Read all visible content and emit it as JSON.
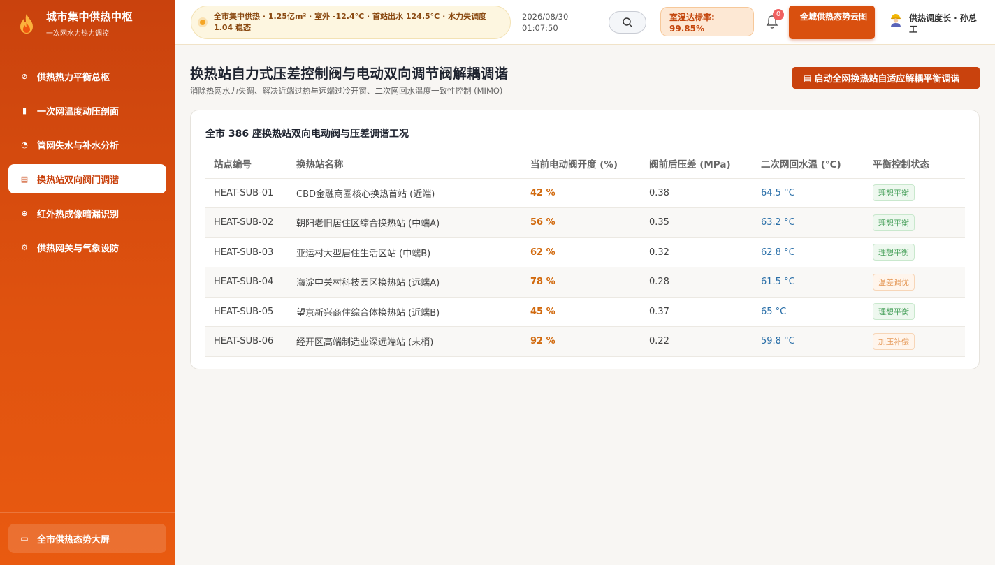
{
  "sidebar": {
    "brand_title": "城市集中供热中枢",
    "brand_sub": "一次网水力热力调控",
    "items": [
      {
        "icon": "compass-icon",
        "glyph": "⊘",
        "label": "供热热力平衡总枢"
      },
      {
        "icon": "bar-chart-icon",
        "glyph": "▮",
        "label": "一次网温度动压剖面"
      },
      {
        "icon": "gauge-icon",
        "glyph": "◔",
        "label": "管网失水与补水分析"
      },
      {
        "icon": "valve-panel-icon",
        "glyph": "▤",
        "label": "换热站双向阀门调谐"
      },
      {
        "icon": "crosshair-icon",
        "glyph": "⊕",
        "label": "红外热成像暗漏识别"
      },
      {
        "icon": "gear-icon",
        "glyph": "⚙",
        "label": "供热网关与气象设防"
      }
    ],
    "active_index": 3,
    "footer_label": "全市供热态势大屏",
    "footer_icon": "monitor-icon"
  },
  "header": {
    "ticker": "全市集中供热 · 1.25亿m² · 室外 -12.4°C · 首站出水 124.5°C · 水力失调度 1.04 稳态",
    "date": "2026/08/30",
    "time": "01:07:50",
    "rate_label": "室温达标率:",
    "rate_value": "99.85%",
    "bell_count": "0",
    "cloud_button": "全城供热态势云图",
    "user_name": "供热调度长 · 孙总工"
  },
  "main": {
    "title": "换热站自力式压差控制阀与电动双向调节阀解耦调谐",
    "subtitle": "消除热网水力失调、解决近端过热与远端过冷开窗、二次网回水温度一致性控制 (MIMO)",
    "action_button": "启动全网换热站自适应解耦平衡调谐",
    "card_title": "全市 386 座换热站双向电动阀与压差调谐工况",
    "columns": [
      "站点编号",
      "换热站名称",
      "当前电动阀开度 (%)",
      "阀前后压差 (MPa)",
      "二次网回水温 (°C)",
      "平衡控制状态"
    ],
    "rows": [
      {
        "id": "HEAT-SUB-01",
        "name": "CBD金融商圈核心换热首站 (近端)",
        "opening": "42 %",
        "pressure": "0.38",
        "temp": "64.5 °C",
        "status": "理想平衡",
        "status_type": "ok"
      },
      {
        "id": "HEAT-SUB-02",
        "name": "朝阳老旧居住区综合换热站 (中端A)",
        "opening": "56 %",
        "pressure": "0.35",
        "temp": "63.2 °C",
        "status": "理想平衡",
        "status_type": "ok"
      },
      {
        "id": "HEAT-SUB-03",
        "name": "亚运村大型居住生活区站 (中端B)",
        "opening": "62 %",
        "pressure": "0.32",
        "temp": "62.8 °C",
        "status": "理想平衡",
        "status_type": "ok"
      },
      {
        "id": "HEAT-SUB-04",
        "name": "海淀中关村科技园区换热站 (远端A)",
        "opening": "78 %",
        "pressure": "0.28",
        "temp": "61.5 °C",
        "status": "温差调优",
        "status_type": "warn"
      },
      {
        "id": "HEAT-SUB-05",
        "name": "望京新兴商住综合体换热站 (近端B)",
        "opening": "45 %",
        "pressure": "0.37",
        "temp": "65 °C",
        "status": "理想平衡",
        "status_type": "ok"
      },
      {
        "id": "HEAT-SUB-06",
        "name": "经开区高端制造业深远端站 (末梢)",
        "opening": "92 %",
        "pressure": "0.22",
        "temp": "59.8 °C",
        "status": "加压补偿",
        "status_type": "warn"
      }
    ]
  },
  "colors": {
    "brand_orange": "#c9420d",
    "accent_orange": "#d9500f",
    "ok_green": "#4aa25d",
    "temp_blue": "#2a6fa8"
  }
}
